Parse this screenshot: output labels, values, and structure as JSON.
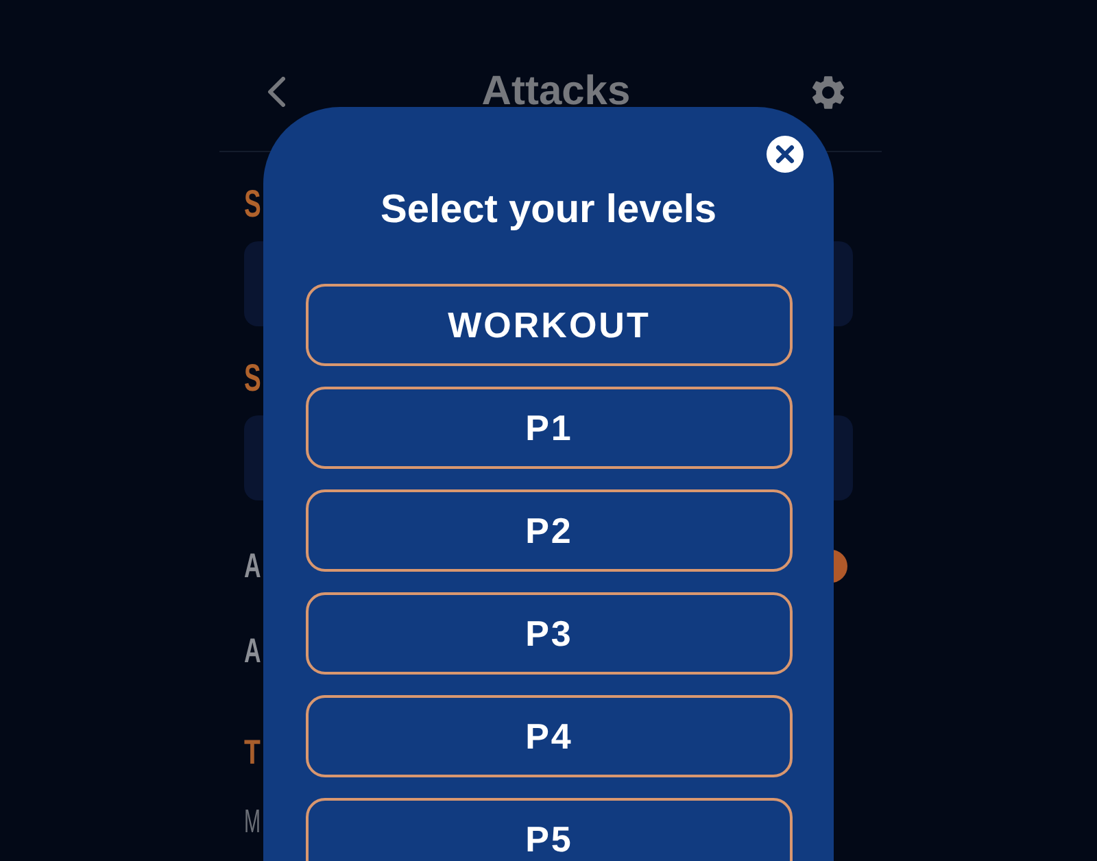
{
  "header": {
    "title": "Attacks"
  },
  "settings": [
    {
      "kind": "select",
      "label": "S"
    },
    {
      "kind": "select",
      "label": "S"
    },
    {
      "kind": "switch",
      "label": "A",
      "on": true
    },
    {
      "kind": "switch",
      "label": "A",
      "on": false
    },
    {
      "kind": "heading",
      "label": "T"
    },
    {
      "kind": "text",
      "label": "M"
    }
  ],
  "modal": {
    "title": "Select your levels",
    "options": [
      {
        "label": "WORKOUT",
        "selected": false
      },
      {
        "label": "P1",
        "selected": false
      },
      {
        "label": "P2",
        "selected": false
      },
      {
        "label": "P3",
        "selected": false
      },
      {
        "label": "P4",
        "selected": false
      },
      {
        "label": "P5",
        "selected": false
      }
    ]
  }
}
